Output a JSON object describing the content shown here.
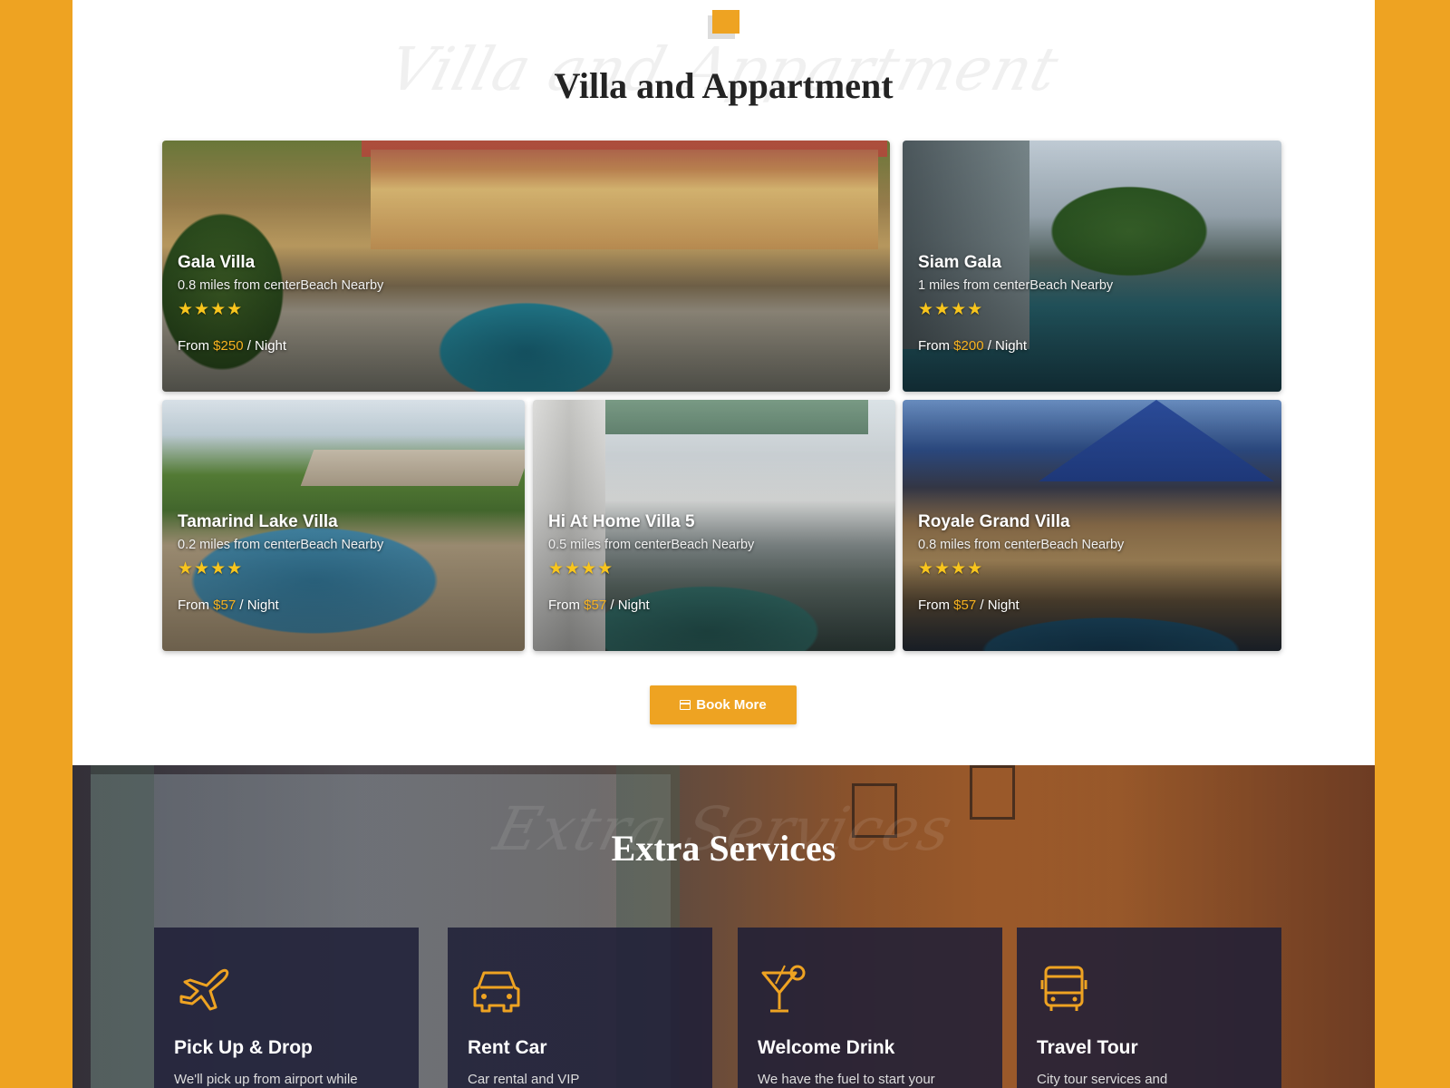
{
  "villa_section": {
    "title": "Villa and Appartment",
    "script_text": "Villa and Appartment",
    "cards": [
      {
        "name": "Gala Villa",
        "distance": "0.8 miles from centerBeach Nearby",
        "stars": "★★★★",
        "price_prefix": "From ",
        "price": "$250",
        "price_suffix": " / Night"
      },
      {
        "name": "Siam Gala",
        "distance": "1 miles from centerBeach Nearby",
        "stars": "★★★★",
        "price_prefix": "From ",
        "price": "$200",
        "price_suffix": " / Night"
      },
      {
        "name": "Tamarind Lake Villa",
        "distance": "0.2 miles from centerBeach Nearby",
        "stars": "★★★★",
        "price_prefix": "From ",
        "price": "$57",
        "price_suffix": " / Night"
      },
      {
        "name": "Hi At Home Villa 5",
        "distance": "0.5 miles from centerBeach Nearby",
        "stars": "★★★★",
        "price_prefix": "From ",
        "price": "$57",
        "price_suffix": " / Night"
      },
      {
        "name": "Royale Grand Villa",
        "distance": "0.8 miles from centerBeach Nearby",
        "stars": "★★★★",
        "price_prefix": "From ",
        "price": "$57",
        "price_suffix": " / Night"
      }
    ],
    "book_button": "Book More",
    "book_icon": "calendar-icon"
  },
  "services_section": {
    "title": "Extra Services",
    "script_text": "Extra Services",
    "cards": [
      {
        "icon": "airplane-icon",
        "title": "Pick Up & Drop",
        "desc": "We'll pick up from airport while"
      },
      {
        "icon": "car-icon",
        "title": "Rent Car",
        "desc": "Car rental and VIP"
      },
      {
        "icon": "cocktail-icon",
        "title": "Welcome Drink",
        "desc": "We have the fuel to start your"
      },
      {
        "icon": "bus-icon",
        "title": "Travel Tour",
        "desc": "City tour services and"
      }
    ]
  },
  "colors": {
    "accent": "#eea322",
    "title": "#232323",
    "star": "#f8c51d",
    "service_card": "#1e1e37"
  }
}
